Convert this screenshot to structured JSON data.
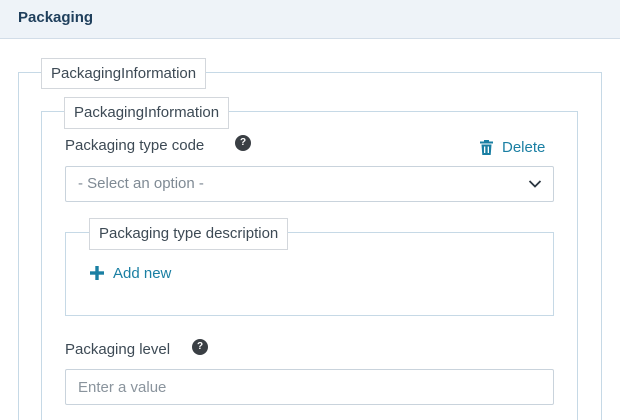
{
  "header": {
    "title": "Packaging"
  },
  "outer_group": {
    "legend": "PackagingInformation"
  },
  "inner_group": {
    "legend": "PackagingInformation",
    "delete_label": "Delete",
    "packaging_type_code": {
      "label": "Packaging type code",
      "help": "?",
      "selected": "- Select an option -"
    },
    "packaging_type_description": {
      "legend": "Packaging type description",
      "add_label": "Add new"
    },
    "packaging_level": {
      "label": "Packaging level",
      "help": "?",
      "placeholder": "Enter a value"
    }
  },
  "colors": {
    "accent": "#1a7fa3",
    "header_bg": "#eef3f8",
    "border": "#c6d9e6"
  },
  "icons": {
    "help": "help-circle-icon",
    "delete": "trash-icon",
    "dropdown": "chevron-down-icon",
    "add": "plus-icon"
  }
}
